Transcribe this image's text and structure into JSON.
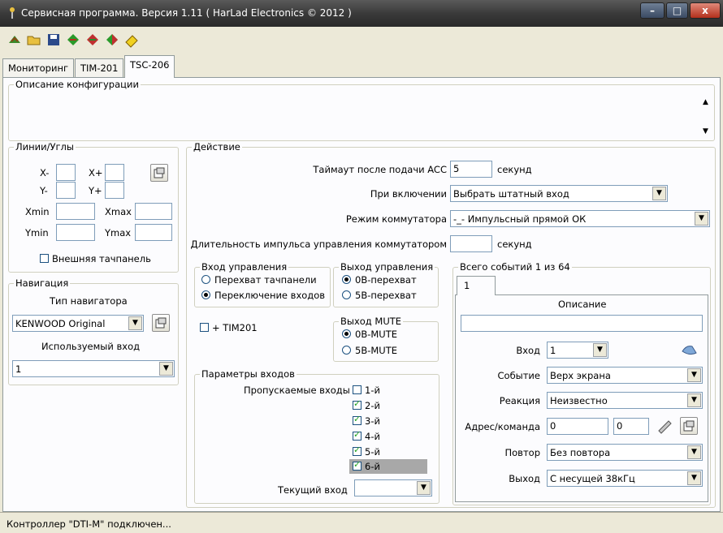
{
  "window": {
    "title": "Сервисная программа. Версия 1.11 ( HarLad Electronics © 2012 )",
    "minimize": "–",
    "maximize": "□",
    "close": "x"
  },
  "toolbar": {
    "icons": [
      "connect-icon",
      "open-folder-icon",
      "save-icon",
      "read-device-icon",
      "write-device-icon",
      "defaults-icon",
      "eraser-icon"
    ]
  },
  "tabs": [
    {
      "label": "Мониторинг"
    },
    {
      "label": "TIM-201"
    },
    {
      "label": "TSC-206"
    }
  ],
  "config_description": {
    "legend": "Описание конфигурации"
  },
  "lines_angles": {
    "legend": "Линии/Углы",
    "x_minus": "X-",
    "x_plus": "X+",
    "y_minus": "Y-",
    "y_plus": "Y+",
    "xmin": "Xmin",
    "xmax": "Xmax",
    "ymin": "Ymin",
    "ymax": "Ymax",
    "ext_touch": "Внешняя тачпанель"
  },
  "navigation": {
    "legend": "Навигация",
    "type_label": "Тип навигатора",
    "type_value": "KENWOOD Original",
    "input_label": "Используемый вход",
    "input_value": "1"
  },
  "action": {
    "legend": "Действие",
    "timeout_label": "Таймаут после подачи ACC",
    "timeout_value": "5",
    "timeout_unit": "секунд",
    "on_power_label": "При включении",
    "on_power_value": "Выбрать штатный вход",
    "mode_label": "Режим коммутатора",
    "mode_value": "-_- Импульсный прямой ОК",
    "pulse_label": "Длительность импульса управления коммутатором",
    "pulse_value": "",
    "pulse_unit": "секунд"
  },
  "control_input": {
    "legend": "Вход управления",
    "opt1": "Перехват тачпанели",
    "opt2": "Переключение входов"
  },
  "control_output": {
    "legend": "Выход управления",
    "opt1": "0В-перехват",
    "opt2": "5В-перехват"
  },
  "tim201": "+ TIM201",
  "mute_output": {
    "legend": "Выход MUTE",
    "opt1": "0B-MUTE",
    "opt2": "5B-MUTE"
  },
  "input_params": {
    "legend": "Параметры входов",
    "skip_label": "Пропускаемые входы",
    "inputs": [
      {
        "label": "1-й",
        "checked": false
      },
      {
        "label": "2-й",
        "checked": true
      },
      {
        "label": "3-й",
        "checked": true
      },
      {
        "label": "4-й",
        "checked": true
      },
      {
        "label": "5-й",
        "checked": true
      },
      {
        "label": "6-й",
        "checked": true
      }
    ],
    "current_label": "Текущий вход",
    "current_value": ""
  },
  "events": {
    "legend": "Всего событий 1 из 64",
    "tab": "1",
    "desc_label": "Описание",
    "desc_value": "",
    "input_label": "Вход",
    "input_value": "1",
    "event_label": "Событие",
    "event_value": "Верх экрана",
    "reaction_label": "Реакция",
    "reaction_value": "Неизвестно",
    "address_label": "Адрес/команда",
    "address_value": "0",
    "command_value": "0",
    "repeat_label": "Повтор",
    "repeat_value": "Без повтора",
    "output_label": "Выход",
    "output_value": "С несущей 38кГц"
  },
  "status": "Контроллер \"DTI-M\" подключен..."
}
